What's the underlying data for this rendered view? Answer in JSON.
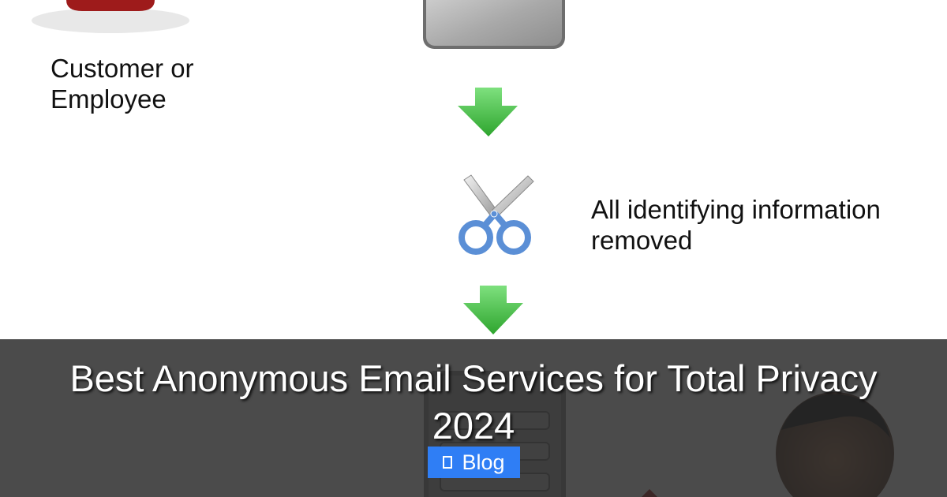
{
  "diagram": {
    "customer_label": [
      "Customer or",
      "Employee"
    ],
    "removed_label": [
      "All identifying information",
      "removed"
    ]
  },
  "overlay": {
    "title": "Best Anonymous Email Services for Total Privacy 2024",
    "category_label": "Blog",
    "category_icon": "folder-icon",
    "badge_color": "#2f7ef5"
  },
  "colors": {
    "arrow_green": "#3cbb3c",
    "scissor_blue": "#5b8fd6",
    "person_icon_red": "#9e1b1b",
    "overlay": "#282828"
  }
}
